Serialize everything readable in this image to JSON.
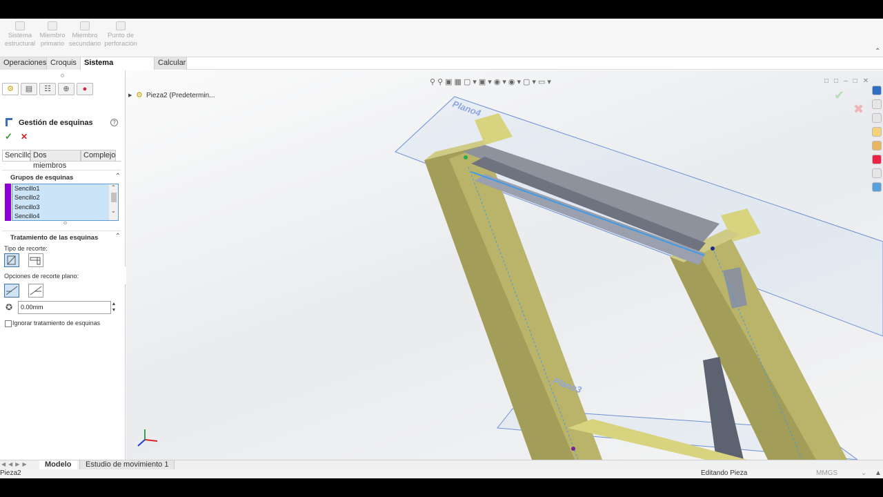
{
  "ribbon": {
    "buttons": [
      {
        "label": "Sistema\nestructural",
        "icon": "structure-system-icon"
      },
      {
        "label": "Miembro\nprimario",
        "icon": "primary-member-icon"
      },
      {
        "label": "Miembro\nsecundario",
        "icon": "secondary-member-icon"
      },
      {
        "label": "Punto de\nperforación",
        "icon": "pierce-point-icon"
      }
    ]
  },
  "tabs": [
    "Operaciones",
    "Croquis",
    "Sistema estructural",
    "Calcular"
  ],
  "active_tab": "Sistema estructural",
  "tree": {
    "part_label": "Pieza2  (Predetermin..."
  },
  "panel": {
    "title": "Gestión de esquinas",
    "help_icon": "help-icon",
    "subtabs": [
      "Sencillo",
      "Dos miembros",
      "Complejo"
    ],
    "groups_header": "Grupos de esquinas",
    "groups": [
      "Sencillo1",
      "Sencillo2",
      "Sencillo3",
      "Sencillo4"
    ],
    "treatment_header": "Tratamiento de las esquinas",
    "trim_type_label": "Tipo de recorte:",
    "planar_options_label": "Opciones de recorte plano:",
    "gap_value": "0.00mm",
    "ignore_label": "Ignorar tratamiento de esquinas",
    "ignore_checked": false
  },
  "viewport": {
    "plane_top": "Plano4",
    "plane_bottom": "Plano3"
  },
  "bottom_tabs": [
    "Modelo",
    "Estudio de movimiento 1"
  ],
  "status": {
    "left": "Pieza2",
    "mode": "Editando Pieza",
    "units": "MMGS"
  },
  "colors": {
    "beam": "#b5b063",
    "beam_dark": "#8a8548",
    "selection": "#cce4f7",
    "group_color": "#8b00d8"
  }
}
